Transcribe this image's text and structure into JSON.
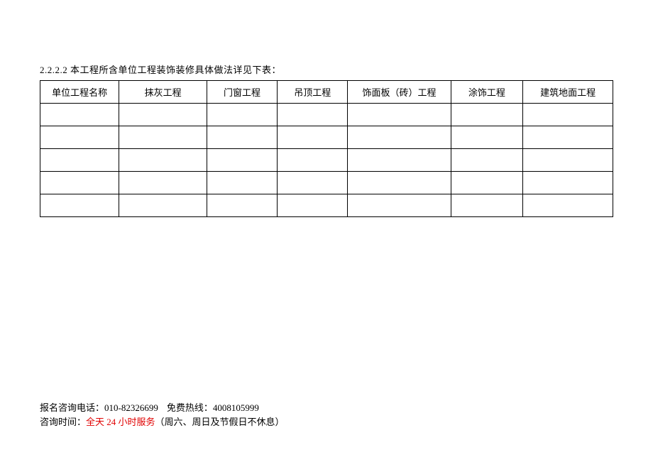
{
  "section_title": "2.2.2.2 本工程所含单位工程装饰装修具体做法详见下表：",
  "table": {
    "headers": [
      "单位工程名称",
      "抹灰工程",
      "门窗工程",
      "吊顶工程",
      "饰面板（砖）工程",
      "涂饰工程",
      "建筑地面工程"
    ],
    "rows": [
      [
        "",
        "",
        "",
        "",
        "",
        "",
        ""
      ],
      [
        "",
        "",
        "",
        "",
        "",
        "",
        ""
      ],
      [
        "",
        "",
        "",
        "",
        "",
        "",
        ""
      ],
      [
        "",
        "",
        "",
        "",
        "",
        "",
        ""
      ],
      [
        "",
        "",
        "",
        "",
        "",
        "",
        ""
      ]
    ]
  },
  "footer": {
    "line1_label1": "报名咨询电话：",
    "line1_phone1": "010-82326699",
    "line1_label2": "免费热线：",
    "line1_phone2": "4008105999",
    "line2_label": "咨询时间：",
    "line2_red": "全天 24 小时服务",
    "line2_rest": "（周六、周日及节假日不休息）"
  }
}
